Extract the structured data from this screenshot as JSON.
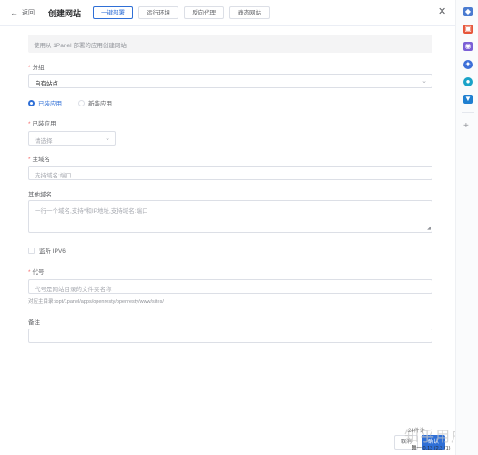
{
  "header": {
    "back_label": "返回",
    "title": "创建网站",
    "tabs": [
      {
        "label": "一键部署",
        "active": true
      },
      {
        "label": "运行环境",
        "active": false
      },
      {
        "label": "反向代理",
        "active": false
      },
      {
        "label": "静态网站",
        "active": false
      }
    ]
  },
  "form": {
    "alert": "使用从 1Panel 部署的应用创建网站",
    "group": {
      "label": "分组",
      "value": "自有站点"
    },
    "source": {
      "options": [
        "已装应用",
        "新装应用"
      ],
      "selected": "已装应用"
    },
    "installed_app": {
      "label": "已装应用",
      "placeholder": "请选择"
    },
    "primary_domain": {
      "label": "主域名",
      "placeholder": "支持域名:端口"
    },
    "other_domains": {
      "label": "其他域名",
      "placeholder": "一行一个域名,支持*和IP地址,支持域名:端口"
    },
    "ipv6": {
      "label": "监听 IPV6"
    },
    "alias": {
      "label": "代号",
      "placeholder": "代号是网站目录的文件夹名称",
      "hint": "对应主目录:/opt/1panel/apps/openresty/openresty/www/sites/"
    },
    "remark": {
      "label": "备注",
      "placeholder": ""
    }
  },
  "footer": {
    "cancel_label": "取消",
    "confirm_label": "确认"
  },
  "watermark": {
    "text": "知乎用户",
    "line1": "24件计",
    "line2": "舞一 0.13 (2.3 (1)"
  },
  "colors": {
    "primary": "#2f6fd6",
    "required": "#f56c6c"
  },
  "sidebar_icons": [
    "tag-icon",
    "toolbox-icon",
    "gamepad-icon",
    "gear-icon",
    "chat-icon",
    "bird-icon",
    "plus-icon"
  ]
}
